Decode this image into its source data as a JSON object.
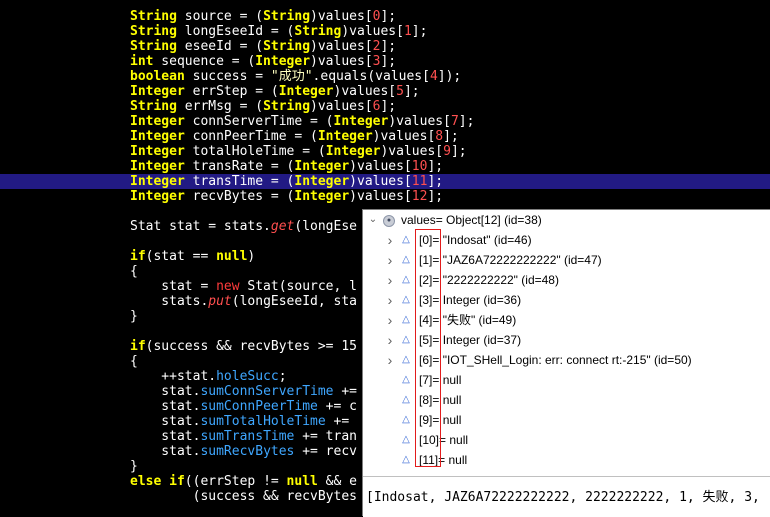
{
  "code_lines": [
    {
      "parts": [
        {
          "c": "ty",
          "t": "String"
        },
        {
          "c": "pl",
          "t": " source = ("
        },
        {
          "c": "ty",
          "t": "String"
        },
        {
          "c": "pl",
          "t": ")values["
        },
        {
          "c": "num",
          "t": "0"
        },
        {
          "c": "pl",
          "t": "];"
        }
      ]
    },
    {
      "parts": [
        {
          "c": "ty",
          "t": "String"
        },
        {
          "c": "pl",
          "t": " longEseeId = ("
        },
        {
          "c": "ty",
          "t": "String"
        },
        {
          "c": "pl",
          "t": ")values["
        },
        {
          "c": "num",
          "t": "1"
        },
        {
          "c": "pl",
          "t": "];"
        }
      ]
    },
    {
      "parts": [
        {
          "c": "ty",
          "t": "String"
        },
        {
          "c": "pl",
          "t": " eseeId = ("
        },
        {
          "c": "ty",
          "t": "String"
        },
        {
          "c": "pl",
          "t": ")values["
        },
        {
          "c": "num",
          "t": "2"
        },
        {
          "c": "pl",
          "t": "];"
        }
      ]
    },
    {
      "parts": [
        {
          "c": "kw",
          "t": "int"
        },
        {
          "c": "pl",
          "t": " sequence = ("
        },
        {
          "c": "ty",
          "t": "Integer"
        },
        {
          "c": "pl",
          "t": ")values["
        },
        {
          "c": "num",
          "t": "3"
        },
        {
          "c": "pl",
          "t": "];"
        }
      ]
    },
    {
      "parts": [
        {
          "c": "kw",
          "t": "boolean"
        },
        {
          "c": "pl",
          "t": " success = "
        },
        {
          "c": "str",
          "t": "\"成功\""
        },
        {
          "c": "pl",
          "t": ".equals(values["
        },
        {
          "c": "num",
          "t": "4"
        },
        {
          "c": "pl",
          "t": "]);"
        }
      ]
    },
    {
      "parts": [
        {
          "c": "ty",
          "t": "Integer"
        },
        {
          "c": "pl",
          "t": " errStep = ("
        },
        {
          "c": "ty",
          "t": "Integer"
        },
        {
          "c": "pl",
          "t": ")values["
        },
        {
          "c": "num",
          "t": "5"
        },
        {
          "c": "pl",
          "t": "];"
        }
      ]
    },
    {
      "parts": [
        {
          "c": "ty",
          "t": "String"
        },
        {
          "c": "pl",
          "t": " errMsg = ("
        },
        {
          "c": "ty",
          "t": "String"
        },
        {
          "c": "pl",
          "t": ")values["
        },
        {
          "c": "num",
          "t": "6"
        },
        {
          "c": "pl",
          "t": "];"
        }
      ]
    },
    {
      "parts": [
        {
          "c": "ty",
          "t": "Integer"
        },
        {
          "c": "pl",
          "t": " connServerTime = ("
        },
        {
          "c": "ty",
          "t": "Integer"
        },
        {
          "c": "pl",
          "t": ")values["
        },
        {
          "c": "num",
          "t": "7"
        },
        {
          "c": "pl",
          "t": "];"
        }
      ]
    },
    {
      "parts": [
        {
          "c": "ty",
          "t": "Integer"
        },
        {
          "c": "pl",
          "t": " connPeerTime = ("
        },
        {
          "c": "ty",
          "t": "Integer"
        },
        {
          "c": "pl",
          "t": ")values["
        },
        {
          "c": "num",
          "t": "8"
        },
        {
          "c": "pl",
          "t": "];"
        }
      ]
    },
    {
      "parts": [
        {
          "c": "ty",
          "t": "Integer"
        },
        {
          "c": "pl",
          "t": " totalHoleTime = ("
        },
        {
          "c": "ty",
          "t": "Integer"
        },
        {
          "c": "pl",
          "t": ")values["
        },
        {
          "c": "num",
          "t": "9"
        },
        {
          "c": "pl",
          "t": "];"
        }
      ]
    },
    {
      "parts": [
        {
          "c": "ty",
          "t": "Integer"
        },
        {
          "c": "pl",
          "t": " transRate = ("
        },
        {
          "c": "ty",
          "t": "Integer"
        },
        {
          "c": "pl",
          "t": ")values["
        },
        {
          "c": "num",
          "t": "10"
        },
        {
          "c": "pl",
          "t": "];"
        }
      ]
    },
    {
      "parts": [
        {
          "c": "ty",
          "t": "Integer"
        },
        {
          "c": "pl",
          "t": " transTime = ("
        },
        {
          "c": "ty",
          "t": "Integer"
        },
        {
          "c": "pl",
          "t": ")values["
        },
        {
          "c": "num",
          "t": "11"
        },
        {
          "c": "pl",
          "t": "];"
        }
      ],
      "hl": true
    },
    {
      "parts": [
        {
          "c": "ty",
          "t": "Integer"
        },
        {
          "c": "pl",
          "t": " recvBytes = ("
        },
        {
          "c": "ty",
          "t": "Integer"
        },
        {
          "c": "pl",
          "t": ")values["
        },
        {
          "c": "num",
          "t": "12"
        },
        {
          "c": "pl",
          "t": "];"
        }
      ]
    },
    {
      "parts": []
    },
    {
      "parts": [
        {
          "c": "pl",
          "t": "Stat stat = stats."
        },
        {
          "c": "mth",
          "t": "get"
        },
        {
          "c": "pl",
          "t": "(longEse"
        }
      ]
    },
    {
      "parts": []
    },
    {
      "parts": [
        {
          "c": "kw",
          "t": "if"
        },
        {
          "c": "pl",
          "t": "(stat == "
        },
        {
          "c": "kw",
          "t": "null"
        },
        {
          "c": "pl",
          "t": ")"
        }
      ]
    },
    {
      "parts": [
        {
          "c": "pl",
          "t": "{"
        }
      ]
    },
    {
      "parts": [
        {
          "c": "pl",
          "t": "    stat = "
        },
        {
          "c": "op",
          "t": "new"
        },
        {
          "c": "pl",
          "t": " Stat(source, l"
        }
      ]
    },
    {
      "parts": [
        {
          "c": "pl",
          "t": "    stats."
        },
        {
          "c": "mth",
          "t": "put"
        },
        {
          "c": "pl",
          "t": "(longEseeId, sta"
        }
      ]
    },
    {
      "parts": [
        {
          "c": "pl",
          "t": "}"
        }
      ]
    },
    {
      "parts": []
    },
    {
      "parts": [
        {
          "c": "kw",
          "t": "if"
        },
        {
          "c": "pl",
          "t": "(success && recvBytes >= 15"
        }
      ]
    },
    {
      "parts": [
        {
          "c": "pl",
          "t": "{"
        }
      ]
    },
    {
      "parts": [
        {
          "c": "pl",
          "t": "    ++stat."
        },
        {
          "c": "fld",
          "t": "holeSucc"
        },
        {
          "c": "pl",
          "t": ";"
        }
      ]
    },
    {
      "parts": [
        {
          "c": "pl",
          "t": "    stat."
        },
        {
          "c": "fld",
          "t": "sumConnServerTime"
        },
        {
          "c": "pl",
          "t": " +="
        }
      ]
    },
    {
      "parts": [
        {
          "c": "pl",
          "t": "    stat."
        },
        {
          "c": "fld",
          "t": "sumConnPeerTime"
        },
        {
          "c": "pl",
          "t": " += c"
        }
      ]
    },
    {
      "parts": [
        {
          "c": "pl",
          "t": "    stat."
        },
        {
          "c": "fld",
          "t": "sumTotalHoleTime"
        },
        {
          "c": "pl",
          "t": " +="
        }
      ]
    },
    {
      "parts": [
        {
          "c": "pl",
          "t": "    stat."
        },
        {
          "c": "fld",
          "t": "sumTransTime"
        },
        {
          "c": "pl",
          "t": " += tran"
        }
      ]
    },
    {
      "parts": [
        {
          "c": "pl",
          "t": "    stat."
        },
        {
          "c": "fld",
          "t": "sumRecvBytes"
        },
        {
          "c": "pl",
          "t": " += recv"
        }
      ]
    },
    {
      "parts": [
        {
          "c": "pl",
          "t": "}"
        }
      ]
    },
    {
      "parts": [
        {
          "c": "kw",
          "t": "else if"
        },
        {
          "c": "pl",
          "t": "((errStep != "
        },
        {
          "c": "kw",
          "t": "null"
        },
        {
          "c": "pl",
          "t": " && e"
        }
      ]
    },
    {
      "parts": [
        {
          "c": "pl",
          "t": "        (success && recvBytes"
        }
      ]
    }
  ],
  "debug": {
    "root": {
      "name": "values",
      "value": "Object[12]  (id=38)"
    },
    "items": [
      {
        "label": "[0]",
        "value": "\"Indosat\" (id=46)",
        "expandable": true
      },
      {
        "label": "[1]",
        "value": "\"JAZ6A72222222222\" (id=47)",
        "expandable": true
      },
      {
        "label": "[2]",
        "value": "\"2222222222\" (id=48)",
        "expandable": true
      },
      {
        "label": "[3]",
        "value": "Integer  (id=36)",
        "expandable": true
      },
      {
        "label": "[4]",
        "value": "\"失败\" (id=49)",
        "expandable": true
      },
      {
        "label": "[5]",
        "value": "Integer  (id=37)",
        "expandable": true
      },
      {
        "label": "[6]",
        "value": "\"IOT_SHell_Login: err: connect rt:-215\" (id=50)",
        "expandable": true
      },
      {
        "label": "[7]",
        "value": "null",
        "expandable": false
      },
      {
        "label": "[8]",
        "value": "null",
        "expandable": false
      },
      {
        "label": "[9]",
        "value": "null",
        "expandable": false
      },
      {
        "label": "[10]",
        "value": "null",
        "expandable": false
      },
      {
        "label": "[11]",
        "value": "null",
        "expandable": false
      }
    ],
    "detail_text": "[Indosat, JAZ6A72222222222, 2222222222, 1, 失败, 3,"
  }
}
